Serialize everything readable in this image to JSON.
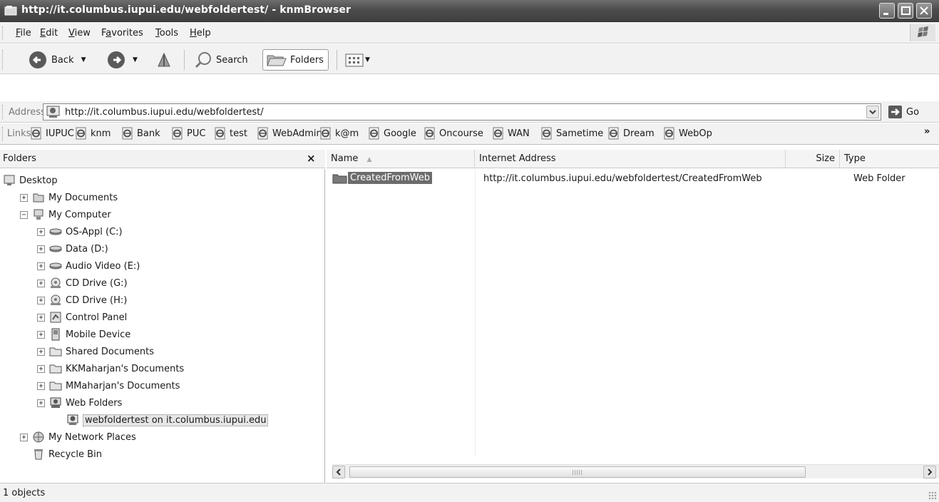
{
  "window": {
    "title": "http://it.columbus.iupui.edu/webfoldertest/ - knmBrowser"
  },
  "menu": [
    {
      "pre": "",
      "key": "F",
      "post": "ile"
    },
    {
      "pre": "",
      "key": "E",
      "post": "dit"
    },
    {
      "pre": "",
      "key": "V",
      "post": "iew"
    },
    {
      "pre": "F",
      "key": "a",
      "post": "vorites"
    },
    {
      "pre": "",
      "key": "T",
      "post": "ools"
    },
    {
      "pre": "",
      "key": "H",
      "post": "elp"
    }
  ],
  "toolbar": {
    "back_label": "Back",
    "search_label": "Search",
    "folders_label": "Folders"
  },
  "address": {
    "label": "Address",
    "url": "http://it.columbus.iupui.edu/webfoldertest/",
    "go_label": "Go"
  },
  "links": {
    "label": "Links",
    "items": [
      "IUPUC",
      "knm",
      "Bank",
      "PUC",
      "test",
      "WebAdmin",
      "k@m",
      "Google",
      "Oncourse",
      "WAN",
      "Sametime",
      "Dream",
      "WebOp"
    ],
    "more": "»"
  },
  "folders_pane": {
    "title": "Folders",
    "close": "×",
    "tree": [
      {
        "label": "Desktop",
        "icon": "desktop-icon",
        "expander": ""
      },
      {
        "label": "My Documents",
        "icon": "my-documents-icon",
        "expander": "+"
      },
      {
        "label": "My Computer",
        "icon": "my-computer-icon",
        "expander": "−"
      },
      {
        "label": "OS-Appl (C:)",
        "icon": "hard-drive-icon",
        "expander": "+"
      },
      {
        "label": "Data (D:)",
        "icon": "hard-drive-icon",
        "expander": "+"
      },
      {
        "label": "Audio Video (E:)",
        "icon": "hard-drive-icon",
        "expander": "+"
      },
      {
        "label": "CD Drive (G:)",
        "icon": "cd-drive-icon",
        "expander": "+"
      },
      {
        "label": "CD Drive (H:)",
        "icon": "cd-drive-icon",
        "expander": "+"
      },
      {
        "label": "Control Panel",
        "icon": "control-panel-icon",
        "expander": "+"
      },
      {
        "label": "Mobile Device",
        "icon": "mobile-device-icon",
        "expander": "+"
      },
      {
        "label": "Shared Documents",
        "icon": "folder-icon",
        "expander": "+"
      },
      {
        "label": "KKMaharjan's Documents",
        "icon": "folder-icon",
        "expander": "+"
      },
      {
        "label": "MMaharjan's Documents",
        "icon": "folder-icon",
        "expander": "+"
      },
      {
        "label": "Web Folders",
        "icon": "web-folders-icon",
        "expander": "+"
      },
      {
        "label": "webfoldertest on it.columbus.iupui.edu",
        "icon": "web-folder-icon",
        "expander": ""
      },
      {
        "label": "My Network Places",
        "icon": "network-places-icon",
        "expander": "+"
      },
      {
        "label": "Recycle Bin",
        "icon": "recycle-bin-icon",
        "expander": ""
      }
    ]
  },
  "list": {
    "columns": [
      "Name",
      "Internet Address",
      "Size",
      "Type"
    ],
    "rows": [
      {
        "name": "CreatedFromWeb",
        "address": "http://it.columbus.iupui.edu/webfoldertest/CreatedFromWeb",
        "size": "",
        "type": "Web Folder"
      }
    ]
  },
  "status": {
    "text": "1 objects"
  }
}
